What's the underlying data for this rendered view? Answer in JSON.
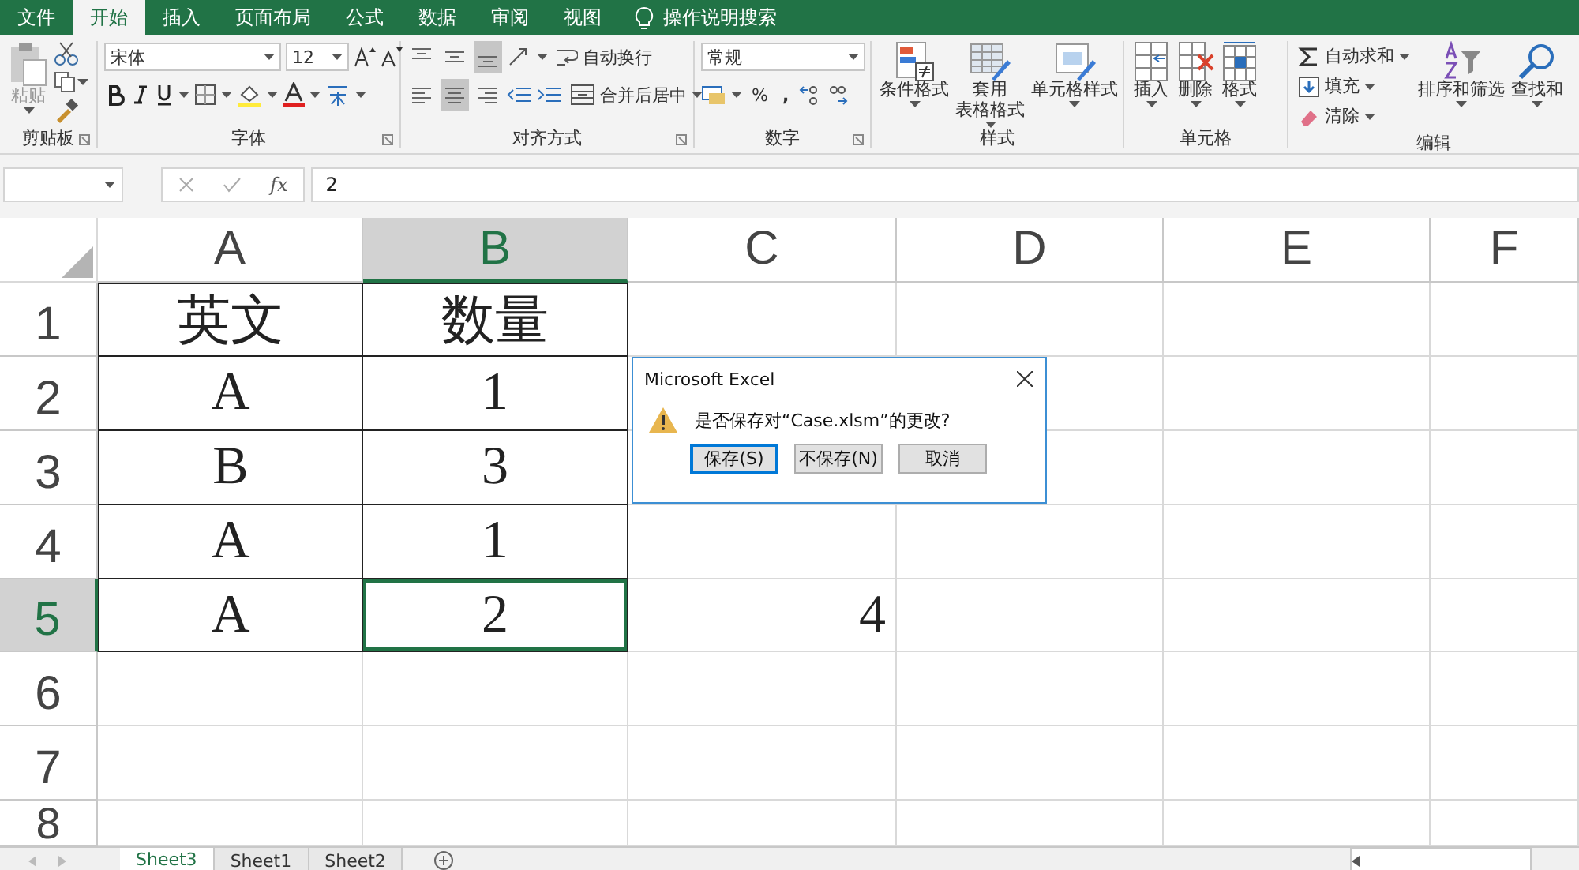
{
  "ribbon_tabs": [
    {
      "label": "文件",
      "selected": false
    },
    {
      "label": "开始",
      "selected": true
    },
    {
      "label": "插入",
      "selected": false
    },
    {
      "label": "页面布局",
      "selected": false
    },
    {
      "label": "公式",
      "selected": false
    },
    {
      "label": "数据",
      "selected": false
    },
    {
      "label": "审阅",
      "selected": false
    },
    {
      "label": "视图",
      "selected": false
    }
  ],
  "tell_me": "操作说明搜索",
  "clipboard": {
    "paste": "粘贴",
    "paste_disabled": true,
    "group": "剪贴板"
  },
  "font": {
    "name": "宋体",
    "size": "12",
    "group": "字体"
  },
  "alignment": {
    "vertical_buttons": [
      {
        "selected": false
      },
      {
        "selected": false
      },
      {
        "selected": true
      }
    ],
    "horizontal_buttons": [
      {
        "selected": false
      },
      {
        "selected": true
      },
      {
        "selected": false
      }
    ],
    "wrap_text": "自动换行",
    "merge": "合并后居中",
    "group": "对齐方式"
  },
  "number": {
    "format": "常规",
    "percent": "%",
    "comma": ",",
    "group": "数字"
  },
  "styles": {
    "buttons": [
      {
        "lines": [
          "条件格式"
        ]
      },
      {
        "lines": [
          "套用",
          "表格格式"
        ]
      },
      {
        "lines": [
          "单元格样式"
        ]
      }
    ],
    "group": "样式"
  },
  "cells": {
    "buttons": [
      "插入",
      "删除",
      "格式"
    ],
    "group": "单元格"
  },
  "editing": {
    "small_buttons": [
      "自动求和",
      "填充",
      "清除"
    ],
    "large_buttons": [
      "排序和筛选",
      "查找和"
    ],
    "group": "编辑"
  },
  "formula_bar": {
    "function_label": "fx",
    "value": "2"
  },
  "sheet": {
    "columns": [
      {
        "label": "A",
        "selected": false
      },
      {
        "label": "B",
        "selected": true
      },
      {
        "label": "C",
        "selected": false
      },
      {
        "label": "D",
        "selected": false
      },
      {
        "label": "E",
        "selected": false
      },
      {
        "label": "F",
        "selected": false
      }
    ],
    "rows": [
      {
        "label": "1",
        "selected": false,
        "cells": [
          {
            "text": "英文",
            "kind": "centered",
            "bordered": true,
            "selected": false
          },
          {
            "text": "数量",
            "kind": "centered",
            "bordered": true,
            "selected": false
          }
        ]
      },
      {
        "label": "2",
        "selected": false,
        "cells": [
          {
            "text": "A",
            "kind": "centered",
            "bordered": true,
            "selected": false
          },
          {
            "text": "1",
            "kind": "centered",
            "bordered": true,
            "selected": false
          }
        ]
      },
      {
        "label": "3",
        "selected": false,
        "cells": [
          {
            "text": "B",
            "kind": "centered",
            "bordered": true,
            "selected": false
          },
          {
            "text": "3",
            "kind": "centered",
            "bordered": true,
            "selected": false
          }
        ]
      },
      {
        "label": "4",
        "selected": false,
        "cells": [
          {
            "text": "A",
            "kind": "centered",
            "bordered": true,
            "selected": false
          },
          {
            "text": "1",
            "kind": "centered",
            "bordered": true,
            "selected": false
          }
        ]
      },
      {
        "label": "5",
        "selected": true,
        "cells": [
          {
            "text": "A",
            "kind": "centered",
            "bordered": true,
            "selected": false
          },
          {
            "text": "2",
            "kind": "centered",
            "bordered": true,
            "selected": true
          },
          {
            "text": "4",
            "kind": "number",
            "bordered": false,
            "selected": false
          }
        ]
      },
      {
        "label": "6",
        "selected": false
      },
      {
        "label": "7",
        "selected": false
      },
      {
        "label": "8",
        "selected": false
      }
    ]
  },
  "dialog": {
    "title": "Microsoft Excel",
    "message": "是否保存对“Case.xlsm”的更改?",
    "buttons": [
      {
        "label": "保存(S)",
        "selected": true
      },
      {
        "label": "不保存(N)",
        "selected": false
      },
      {
        "label": "取消",
        "selected": false
      }
    ]
  },
  "sheet_tabs": [
    {
      "label": "Sheet3",
      "selected": true
    },
    {
      "label": "Sheet1",
      "selected": false
    },
    {
      "label": "Sheet2",
      "selected": false
    }
  ]
}
